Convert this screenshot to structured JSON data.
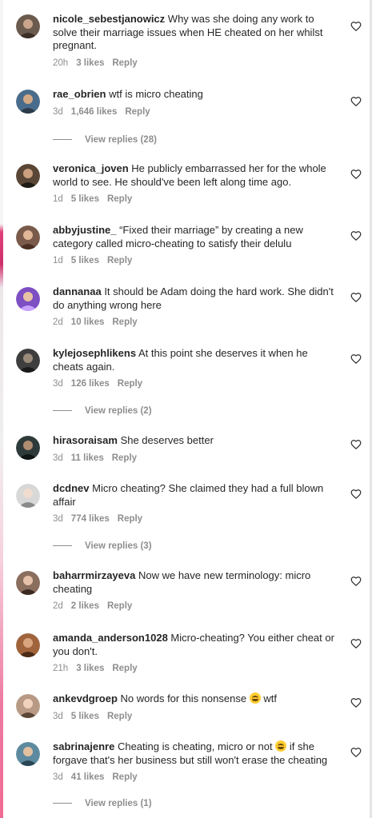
{
  "comments": [
    {
      "user": "nicole_sebestjanowicz",
      "text": "Why was she doing any work to solve their marriage issues when HE cheated on her whilst pregnant.",
      "time": "20h",
      "likes": "3 likes",
      "reply": "Reply",
      "avatar_color": "#6b5a4e"
    },
    {
      "user": "rae_obrien",
      "text": "wtf is micro cheating",
      "time": "3d",
      "likes": "1,646 likes",
      "reply": "Reply",
      "view_replies": "View replies (28)",
      "avatar_color": "#4a6c8c"
    },
    {
      "user": "veronica_joven",
      "text": "He publicly embarrassed her for the whole world to see. He should've been left along time ago.",
      "time": "1d",
      "likes": "5 likes",
      "reply": "Reply",
      "avatar_color": "#5a4636"
    },
    {
      "user": "abbyjustine_",
      "text": "“Fixed their marriage” by creating a new category called micro-cheating to satisfy their delulu",
      "time": "1d",
      "likes": "5 likes",
      "reply": "Reply",
      "avatar_color": "#7a5a4a"
    },
    {
      "user": "dannanaa",
      "text": "It should be Adam doing the hard work. She didn't do anything wrong here",
      "time": "2d",
      "likes": "10 likes",
      "reply": "Reply",
      "avatar_color": "#7d4fc2"
    },
    {
      "user": "kylejosephlikens",
      "text": "At this point she deserves it when he cheats again.",
      "time": "3d",
      "likes": "126 likes",
      "reply": "Reply",
      "view_replies": "View replies (2)",
      "avatar_color": "#3e3e3e"
    },
    {
      "user": "hirasoraisam",
      "text": "She deserves better",
      "time": "3d",
      "likes": "11 likes",
      "reply": "Reply",
      "avatar_color": "#2e3a3a"
    },
    {
      "user": "dcdnev",
      "text": "Micro cheating? She claimed they had a full blown affair",
      "time": "3d",
      "likes": "774 likes",
      "reply": "Reply",
      "view_replies": "View replies (3)",
      "avatar_color": "#d8d8d8"
    },
    {
      "user": "baharrmirzayeva",
      "text": "Now we have new terminology: micro cheating",
      "time": "2d",
      "likes": "2 likes",
      "reply": "Reply",
      "avatar_color": "#8a6e5e"
    },
    {
      "user": "amanda_anderson1028",
      "text": "Micro-cheating? You either cheat or you don't.",
      "time": "21h",
      "likes": "3 likes",
      "reply": "Reply",
      "avatar_color": "#a0643c"
    },
    {
      "user": "ankevdgroep",
      "text": "No words for this nonsense",
      "text_after": " wtf",
      "time": "3d",
      "likes": "5 likes",
      "reply": "Reply",
      "avatar_color": "#b89a84",
      "emoji": "laughing-crying-emoji"
    },
    {
      "user": "sabrinajenre",
      "text": "Cheating is cheating, micro or not",
      "text_after": " if she forgave that's her business but still won't erase the cheating",
      "time": "3d",
      "likes": "41 likes",
      "reply": "Reply",
      "view_replies": "View replies (1)",
      "avatar_color": "#5e8aa0",
      "emoji": "laughing-crying-emoji"
    }
  ]
}
